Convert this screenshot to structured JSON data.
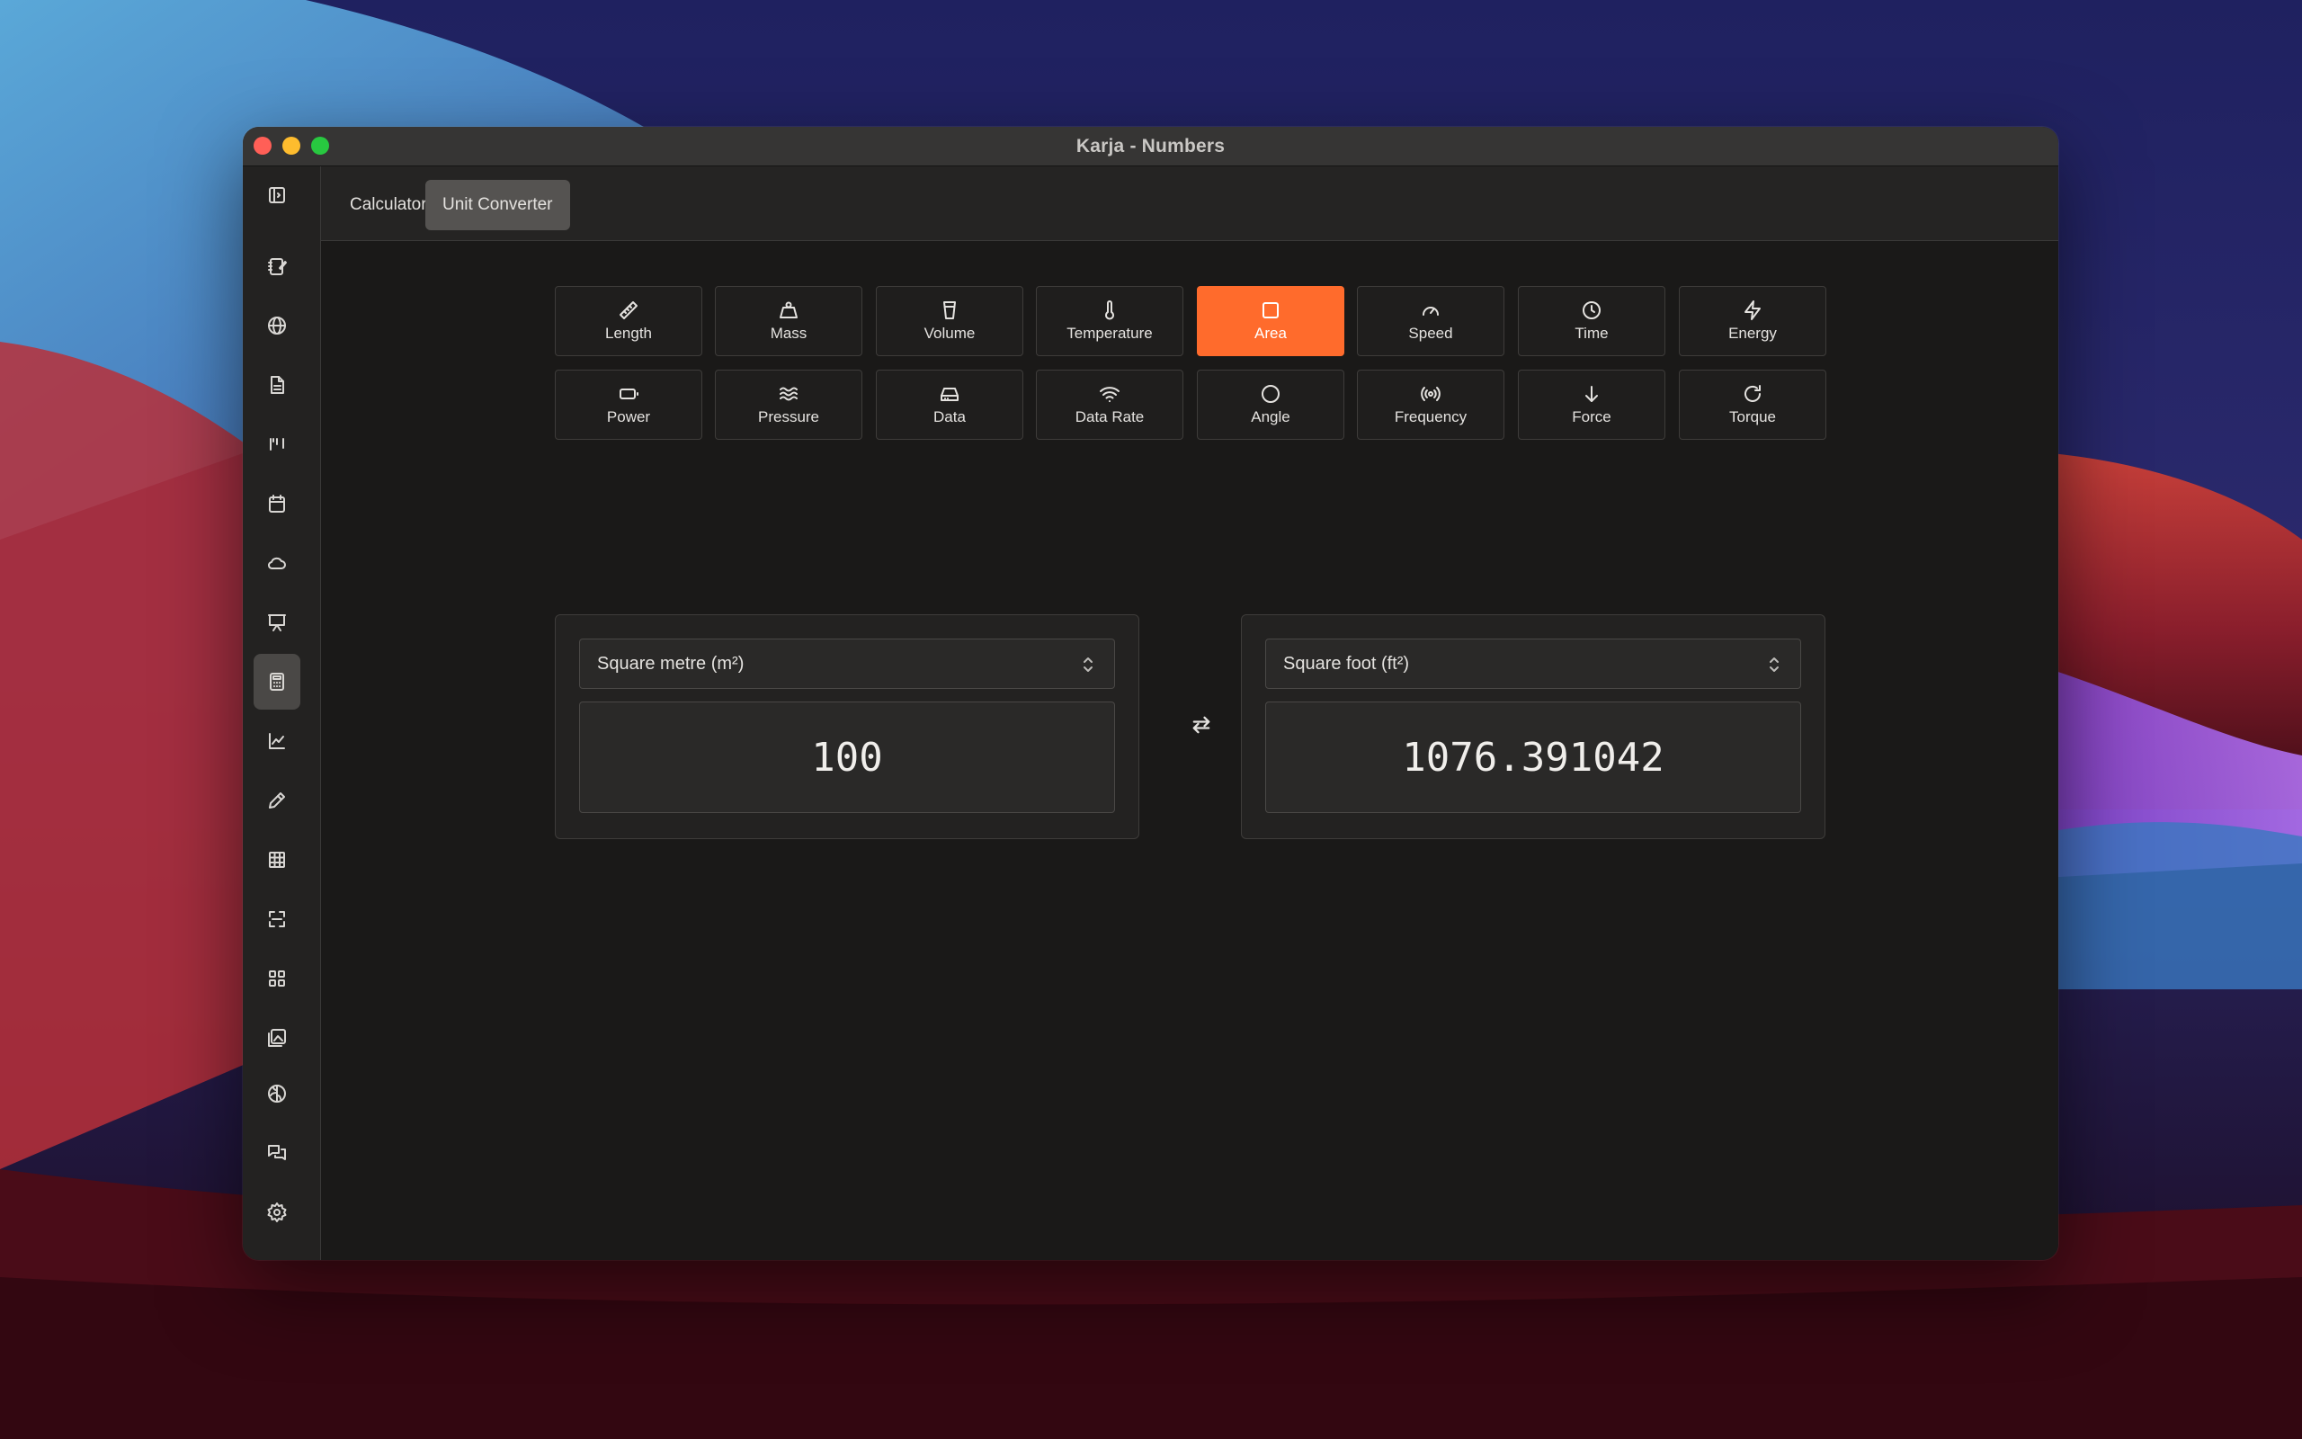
{
  "window": {
    "title": "Karja - Numbers"
  },
  "tabs": [
    {
      "label": "Calculator",
      "selected": false
    },
    {
      "label": "Unit Converter",
      "selected": true
    }
  ],
  "sidebar": {
    "toggle_icon": "sidebar-toggle-icon",
    "items": [
      {
        "icon": "notes-icon"
      },
      {
        "icon": "globe-icon"
      },
      {
        "icon": "document-icon"
      },
      {
        "icon": "kanban-icon"
      },
      {
        "icon": "calendar-icon"
      },
      {
        "icon": "cloud-icon"
      },
      {
        "icon": "presentation-icon"
      },
      {
        "icon": "calculator-icon",
        "active": true
      },
      {
        "icon": "chart-icon"
      },
      {
        "icon": "pencil-icon"
      },
      {
        "icon": "table-icon"
      },
      {
        "icon": "scan-icon"
      },
      {
        "icon": "apps-grid-icon"
      },
      {
        "icon": "gallery-icon"
      },
      {
        "icon": "brain-icon"
      },
      {
        "icon": "chat-icon"
      },
      {
        "icon": "settings-icon"
      }
    ]
  },
  "categories": [
    {
      "label": "Length",
      "icon": "ruler-icon"
    },
    {
      "label": "Mass",
      "icon": "weight-icon"
    },
    {
      "label": "Volume",
      "icon": "cup-icon"
    },
    {
      "label": "Temperature",
      "icon": "thermometer-icon"
    },
    {
      "label": "Area",
      "icon": "square-icon",
      "active": true
    },
    {
      "label": "Speed",
      "icon": "gauge-icon"
    },
    {
      "label": "Time",
      "icon": "clock-icon"
    },
    {
      "label": "Energy",
      "icon": "lightning-icon"
    },
    {
      "label": "Power",
      "icon": "battery-icon"
    },
    {
      "label": "Pressure",
      "icon": "waves-icon"
    },
    {
      "label": "Data",
      "icon": "hard-drive-icon"
    },
    {
      "label": "Data Rate",
      "icon": "wifi-icon"
    },
    {
      "label": "Angle",
      "icon": "circle-icon"
    },
    {
      "label": "Frequency",
      "icon": "radio-waves-icon"
    },
    {
      "label": "Force",
      "icon": "arrow-down-icon"
    },
    {
      "label": "Torque",
      "icon": "rotate-icon"
    }
  ],
  "converter": {
    "from": {
      "unit": "Square metre (m²)",
      "value": "100"
    },
    "to": {
      "unit": "Square foot (ft²)",
      "value": "1076.391042"
    },
    "swap_icon": "swap-arrows-icon"
  },
  "colors": {
    "accent": "#ff6b2c",
    "window_bg": "#1a1918"
  }
}
